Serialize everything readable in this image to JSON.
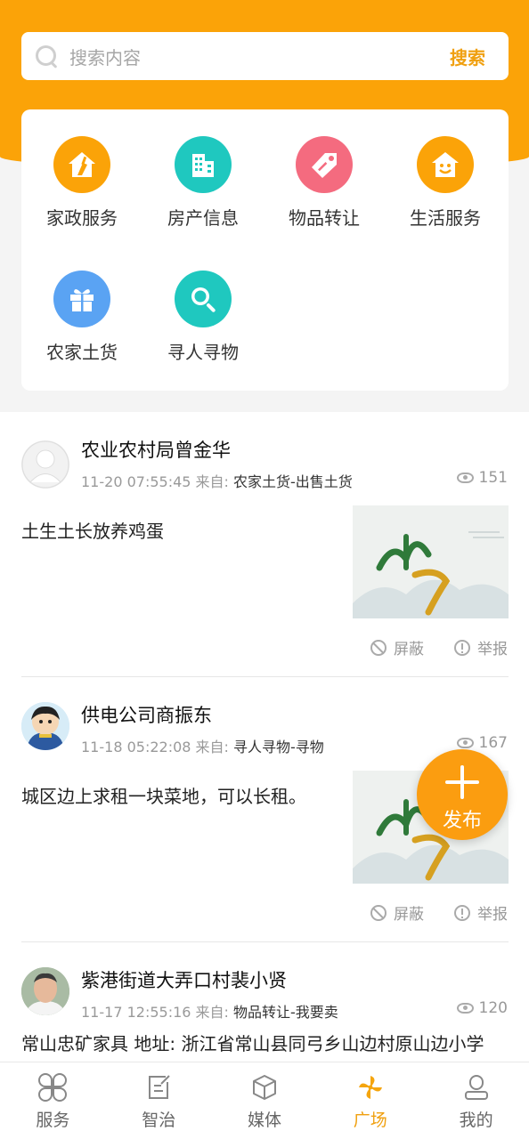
{
  "search": {
    "placeholder": "搜索内容",
    "button_label": "搜索"
  },
  "categories": [
    {
      "label": "家政服务",
      "icon": "broom-house-icon",
      "color": "#fba308"
    },
    {
      "label": "房产信息",
      "icon": "building-icon",
      "color": "#1fc8bf"
    },
    {
      "label": "物品转让",
      "icon": "price-tag-icon",
      "color": "#f46b7f"
    },
    {
      "label": "生活服务",
      "icon": "smile-house-icon",
      "color": "#fba308"
    },
    {
      "label": "农家土货",
      "icon": "gift-icon",
      "color": "#5aa3f3"
    },
    {
      "label": "寻人寻物",
      "icon": "magnifier-icon",
      "color": "#1fc8bf"
    }
  ],
  "posts": [
    {
      "author": "农业农村局曾金华",
      "time": "11-20 07:55:45",
      "from_label": "来自:",
      "source": "农家土货-出售土货",
      "views": "151",
      "text": "土生土长放养鸡蛋",
      "block_label": "屏蔽",
      "report_label": "举报"
    },
    {
      "author": "供电公司商振东",
      "time": "11-18 05:22:08",
      "from_label": "来自:",
      "source": "寻人寻物-寻物",
      "views": "167",
      "text": "城区边上求租一块菜地，可以长租。",
      "block_label": "屏蔽",
      "report_label": "举报"
    },
    {
      "author": "紫港街道大弄口村裴小贤",
      "time": "11-17 12:55:16",
      "from_label": "来自:",
      "source": "物品转让-我要卖",
      "views": "120",
      "text": "常山忠矿家具 地址: 浙江省常山县同弓乡山边村原山边小学"
    }
  ],
  "fab": {
    "label": "发布"
  },
  "tabs": [
    {
      "label": "服务",
      "icon": "grid-petals-icon",
      "active": false
    },
    {
      "label": "智治",
      "icon": "edit-note-icon",
      "active": false
    },
    {
      "label": "媒体",
      "icon": "cube-icon",
      "active": false
    },
    {
      "label": "广场",
      "icon": "pinwheel-icon",
      "active": true
    },
    {
      "label": "我的",
      "icon": "user-icon",
      "active": false
    }
  ],
  "colors": {
    "brand": "#fba308",
    "accent_text": "#f0a010"
  }
}
